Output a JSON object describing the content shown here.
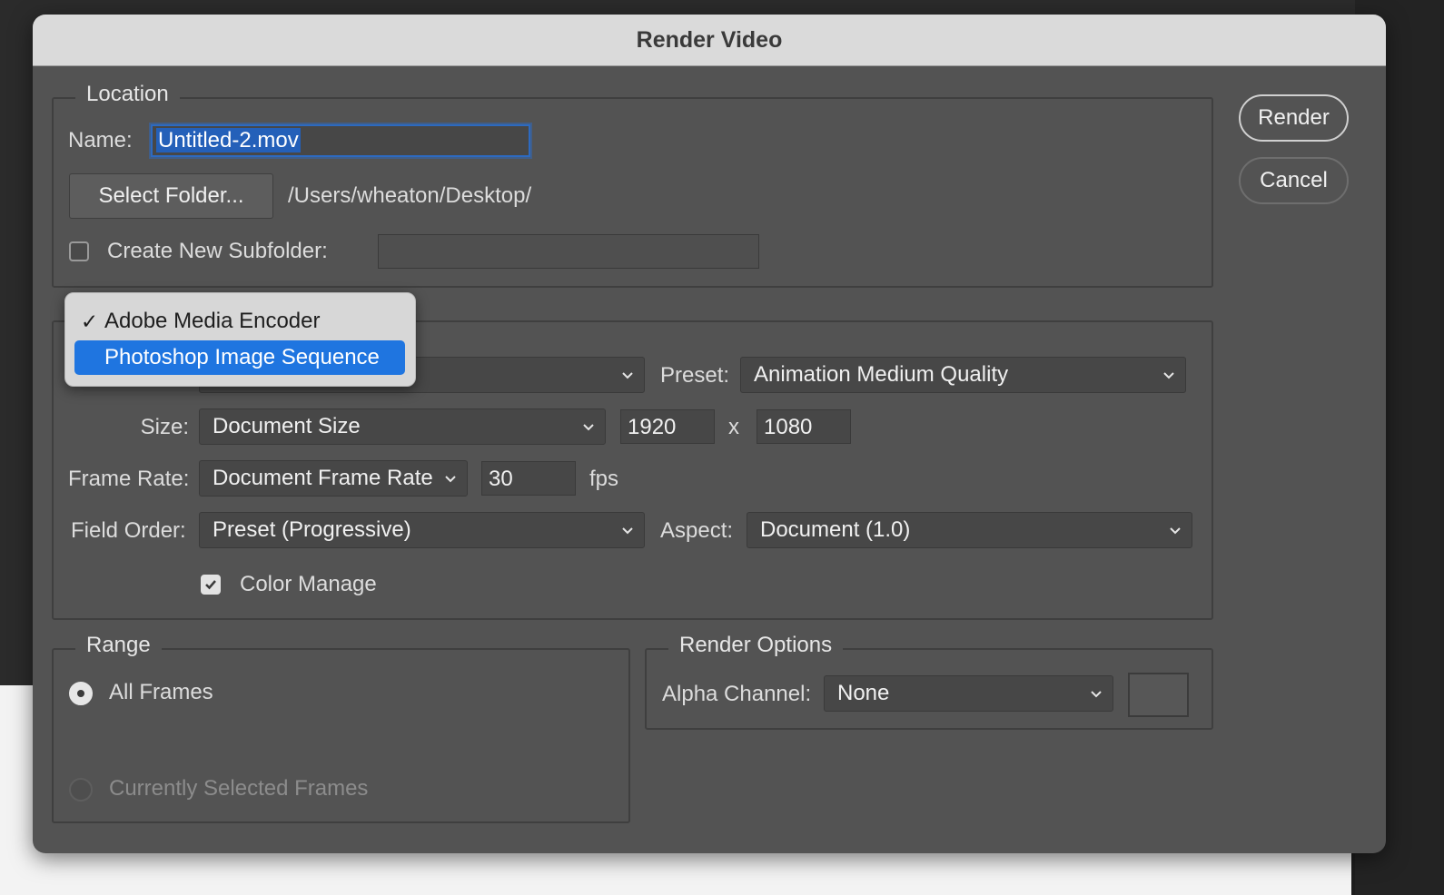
{
  "dialog": {
    "title": "Render Video",
    "render_button": "Render",
    "cancel_button": "Cancel"
  },
  "location": {
    "legend": "Location",
    "name_label": "Name:",
    "name_value": "Untitled-2.mov",
    "select_folder_button": "Select Folder...",
    "folder_path": "/Users/wheaton/Desktop/",
    "subfolder_label": "Create New Subfolder:",
    "subfolder_checked": false,
    "subfolder_value": ""
  },
  "encoder_menu": {
    "items": [
      {
        "label": "Adobe Media Encoder",
        "checked": true,
        "highlighted": false
      },
      {
        "label": "Photoshop Image Sequence",
        "checked": false,
        "highlighted": true
      }
    ]
  },
  "settings": {
    "format_value": "",
    "preset_label": "Preset:",
    "preset_value": "Animation Medium Quality",
    "size_label": "Size:",
    "size_value": "Document Size",
    "width_value": "1920",
    "size_separator": "x",
    "height_value": "1080",
    "frame_rate_label": "Frame Rate:",
    "frame_rate_value": "Document Frame Rate",
    "fps_value": "30",
    "fps_unit": "fps",
    "field_order_label": "Field Order:",
    "field_order_value": "Preset (Progressive)",
    "aspect_label": "Aspect:",
    "aspect_value": "Document (1.0)",
    "color_manage_label": "Color Manage",
    "color_manage_checked": true
  },
  "range": {
    "legend": "Range",
    "all_frames_label": "All Frames",
    "all_frames_selected": true,
    "selected_frames_label": "Currently Selected Frames",
    "selected_frames_enabled": false
  },
  "render_options": {
    "legend": "Render Options",
    "alpha_label": "Alpha Channel:",
    "alpha_value": "None"
  },
  "icons": {
    "chevron": "chevron-down-icon",
    "checkmark": "checkmark-icon"
  }
}
